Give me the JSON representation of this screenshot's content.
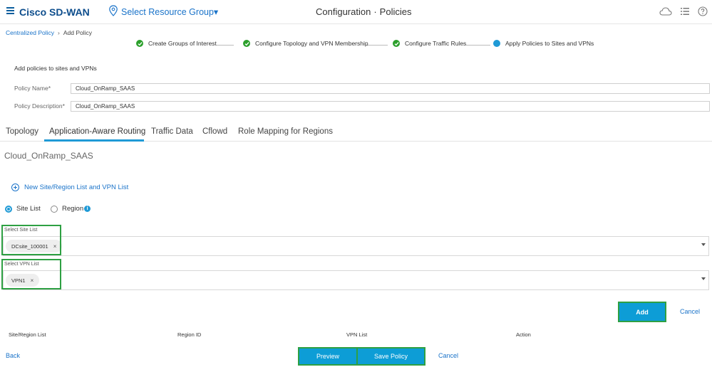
{
  "header": {
    "brand": "Cisco SD-WAN",
    "resource_group": "Select Resource Group▾",
    "title_part1": "Configuration",
    "title_sep": "·",
    "title_part2": "Policies"
  },
  "breadcrumb": {
    "parent": "Centralized Policy",
    "current": "Add Policy"
  },
  "steps": [
    {
      "label": "Create Groups of Interest",
      "status": "done"
    },
    {
      "label": "Configure Topology and VPN Membership",
      "status": "done"
    },
    {
      "label": "Configure Traffic Rules",
      "status": "done"
    },
    {
      "label": "Apply Policies to Sites and VPNs",
      "status": "active"
    }
  ],
  "form": {
    "heading": "Add policies to sites and VPNs",
    "policy_name_label": "Policy Name",
    "policy_name_value": "Cloud_OnRamp_SAAS",
    "policy_desc_label": "Policy Description",
    "policy_desc_value": "Cloud_OnRamp_SAAS",
    "required_mark": "*"
  },
  "tabs": [
    "Topology",
    "Application-Aware Routing",
    "Traffic Data",
    "Cflowd",
    "Role Mapping for Regions"
  ],
  "active_tab": "Application-Aware Routing",
  "section": {
    "policy_title": "Cloud_OnRamp_SAAS",
    "new_link": "New Site/Region List and VPN List",
    "radio_site": "Site List",
    "radio_region": "Region",
    "selected_radio": "Site List",
    "site_label": "Select Site List",
    "site_chip": "DCsite_100001",
    "vpn_label": "Select VPN List",
    "vpn_chip": "VPN1",
    "chip_remove": "×",
    "add_button": "Add",
    "cancel": "Cancel"
  },
  "table_headers": [
    "Site/Region List",
    "Region ID",
    "VPN List",
    "Action"
  ],
  "footer": {
    "back": "Back",
    "preview": "Preview",
    "save": "Save Policy",
    "cancel": "Cancel"
  },
  "colors": {
    "brand": "#0d4d8c",
    "link": "#1a73c9",
    "primary_button": "#0d9dd6",
    "step_done": "#2ca02c",
    "step_active": "#1f9ad6",
    "highlight": "#2ea043"
  },
  "icons": {
    "menu": "hamburger-icon",
    "location": "location-pin-icon",
    "cloud": "cloud-icon",
    "tasks": "list-icon",
    "help": "help-icon",
    "check": "check-icon",
    "info": "info-icon",
    "add": "plus-circle-icon",
    "dropdown": "chevron-down-icon"
  }
}
